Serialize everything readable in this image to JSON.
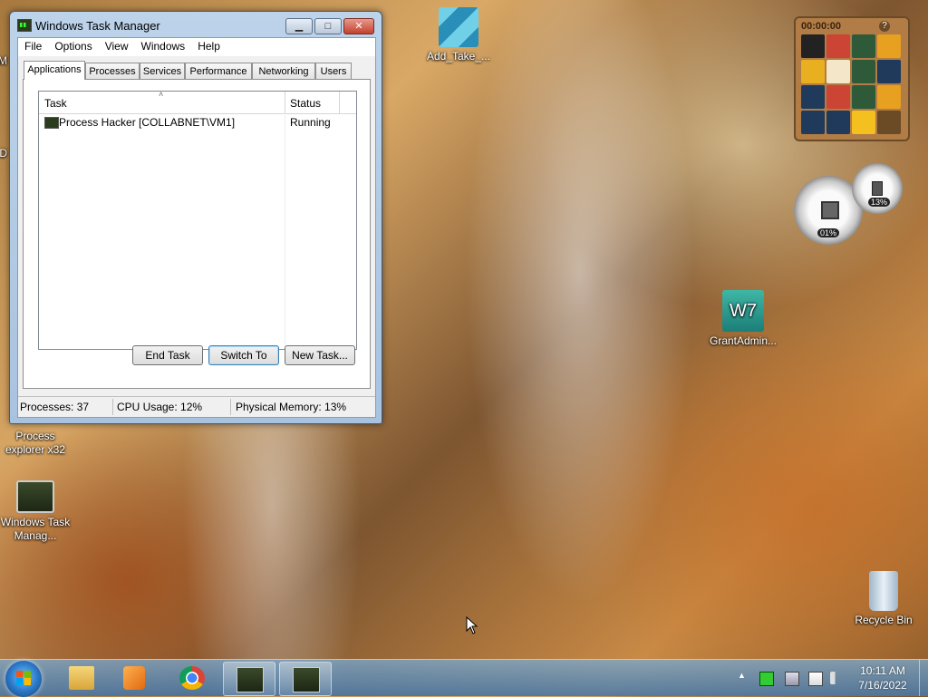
{
  "window": {
    "title": "Windows Task Manager",
    "min_glyph": "▁",
    "max_glyph": "□",
    "close_glyph": "✕"
  },
  "menu": [
    "File",
    "Options",
    "View",
    "Windows",
    "Help"
  ],
  "tabs": [
    "Applications",
    "Processes",
    "Services",
    "Performance",
    "Networking",
    "Users"
  ],
  "active_tab": "Applications",
  "table": {
    "headers": {
      "task": "Task",
      "status": "Status"
    },
    "sort_glyph": "˄",
    "rows": [
      {
        "task": "Process Hacker [COLLABNET\\VM1]",
        "status": "Running"
      }
    ]
  },
  "buttons": {
    "end_task": "End Task",
    "switch_to": "Switch To",
    "new_task": "New Task..."
  },
  "statusbar": {
    "processes": "Processes: 37",
    "cpu": "CPU Usage: 12%",
    "memory": "Physical Memory: 13%"
  },
  "desktop_icons": {
    "add_take": "Add_Take_...",
    "grant_admin": "GrantAdmin...",
    "process_explorer": "Process explorer x32",
    "task_manager": "Windows Task Manag...",
    "recycle_bin": "Recycle Bin",
    "partial_left_1": "M",
    "partial_left_2": "D"
  },
  "gadgets": {
    "puzzle_timer": "00:00:00",
    "puzzle_help": "?",
    "cpu_meter_cpu": "01%",
    "cpu_meter_mem": "13%"
  },
  "taskbar": {
    "clock_time": "10:11 AM",
    "clock_date": "7/16/2022",
    "tray_arrow": "▲"
  },
  "colors": {
    "title_blue": "#bcd3ea",
    "taskbar": "#4a7fb0",
    "close_red": "#c3412e"
  }
}
